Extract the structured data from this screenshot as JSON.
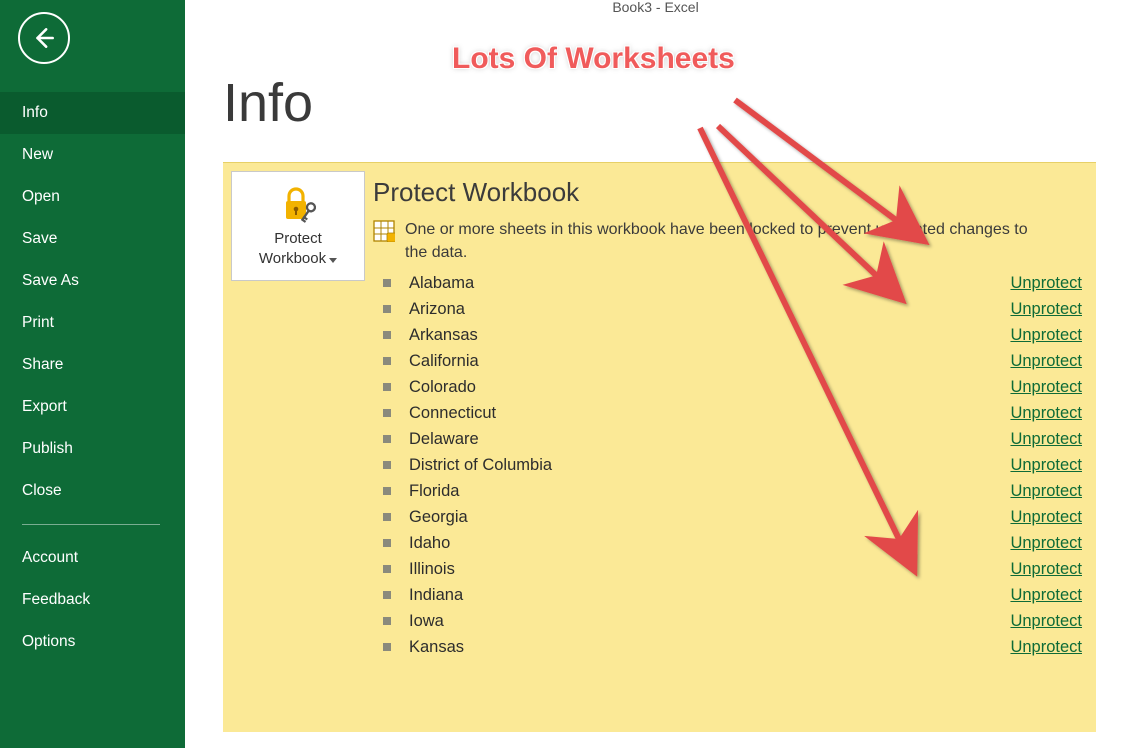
{
  "titlebar": "Book3 - Excel",
  "page_title": "Info",
  "sidebar": {
    "items": [
      {
        "label": "Info",
        "active": true
      },
      {
        "label": "New"
      },
      {
        "label": "Open"
      },
      {
        "label": "Save"
      },
      {
        "label": "Save As"
      },
      {
        "label": "Print"
      },
      {
        "label": "Share"
      },
      {
        "label": "Export"
      },
      {
        "label": "Publish"
      },
      {
        "label": "Close"
      }
    ],
    "footer_items": [
      {
        "label": "Account"
      },
      {
        "label": "Feedback"
      },
      {
        "label": "Options"
      }
    ]
  },
  "protect": {
    "button_line1": "Protect",
    "button_line2": "Workbook",
    "heading": "Protect Workbook",
    "description": "One or more sheets in this workbook have been locked to prevent unwanted changes to the data.",
    "unprotect_label": "Unprotect",
    "sheets": [
      "Alabama",
      "Arizona",
      "Arkansas",
      "California",
      "Colorado",
      "Connecticut",
      "Delaware",
      "District of Columbia",
      "Florida",
      "Georgia",
      "Idaho",
      "Illinois",
      "Indiana",
      "Iowa",
      "Kansas"
    ]
  },
  "annotation": {
    "text": "Lots Of Worksheets"
  },
  "colors": {
    "brand_green": "#0e6b37",
    "panel_yellow": "#fbe996",
    "anno_red": "#f05b5b"
  }
}
